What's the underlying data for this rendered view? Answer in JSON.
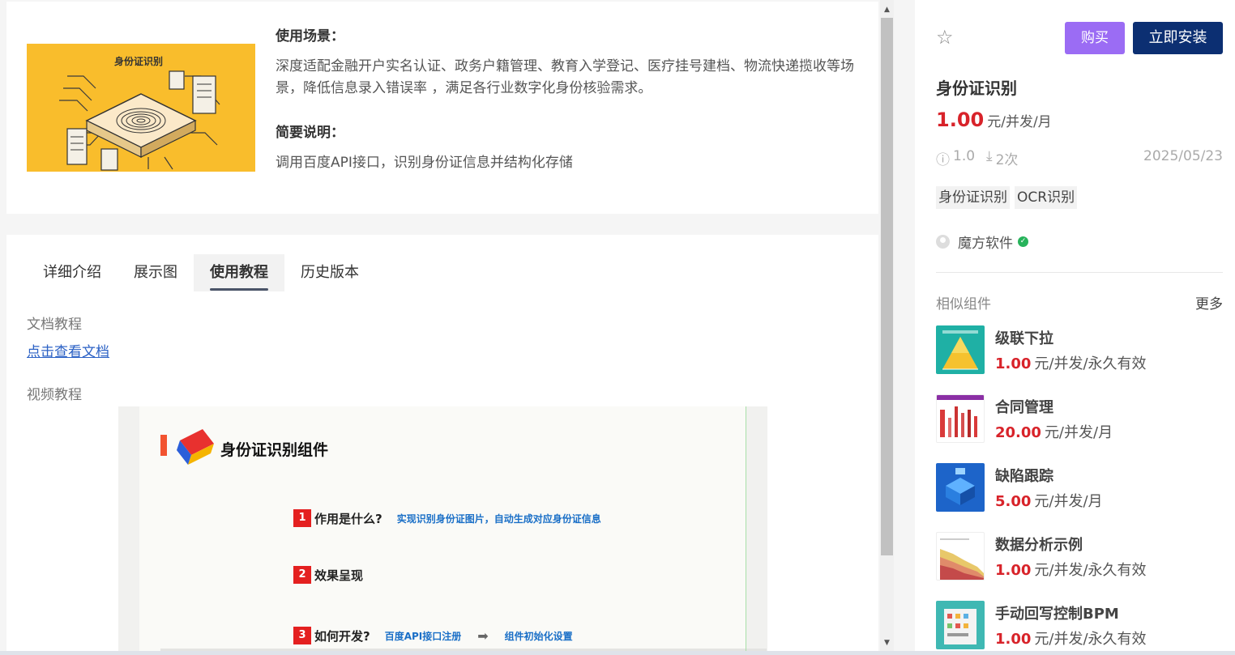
{
  "intro": {
    "cover_title": "身份证识别",
    "scene_heading": "使用场景：",
    "scene_text": "深度适配金融开户实名认证、政务户籍管理、教育入学登记、医疗挂号建档、物流快递揽收等场景，降低信息录入错误率 ，满足各行业数字化身份核验需求。",
    "summary_heading": "简要说明：",
    "summary_text": "调用百度API接口，识别身份证信息并结构化存储"
  },
  "tabs": [
    {
      "label": "详细介绍"
    },
    {
      "label": "展示图"
    },
    {
      "label": "使用教程",
      "active": true
    },
    {
      "label": "历史版本"
    }
  ],
  "tutorial": {
    "doc_label": "文档教程",
    "doc_link": "点击查看文档",
    "video_label": "视频教程"
  },
  "video": {
    "title": "身份证识别组件",
    "items": [
      {
        "num": "1",
        "question": "作用是什么?",
        "answer": "实现识别身份证图片，自动生成对应身份证信息"
      },
      {
        "num": "2",
        "question": "效果呈现"
      },
      {
        "num": "3",
        "question": "如何开发?",
        "step1": "百度API接口注册",
        "step2": "组件初始化设置"
      }
    ]
  },
  "sidebar": {
    "buy_label": "购买",
    "install_label": "立即安装",
    "title": "身份证识别",
    "price": "1.00",
    "price_unit": "元/并发/月",
    "version": "1.0",
    "downloads": "2次",
    "date": "2025/05/23",
    "tags": [
      "身份证识别",
      "OCR识别"
    ],
    "vendor": "魔方软件",
    "similar_heading": "相似组件",
    "more_label": "更多",
    "similar": [
      {
        "name": "级联下拉",
        "price": "1.00",
        "unit": "元/并发/永久有效"
      },
      {
        "name": "合同管理",
        "price": "20.00",
        "unit": "元/并发/月"
      },
      {
        "name": "缺陷跟踪",
        "price": "5.00",
        "unit": "元/并发/月"
      },
      {
        "name": "数据分析示例",
        "price": "1.00",
        "unit": "元/并发/永久有效"
      },
      {
        "name": "手动回写控制BPM",
        "price": "1.00",
        "unit": "元/并发/永久有效"
      }
    ]
  },
  "colors": {
    "accent_price": "#d8232a",
    "buy_button": "#9b6cf4",
    "install_button": "#0c2f72",
    "cover_bg": "#f9bd2c",
    "link": "#2b61c5"
  }
}
